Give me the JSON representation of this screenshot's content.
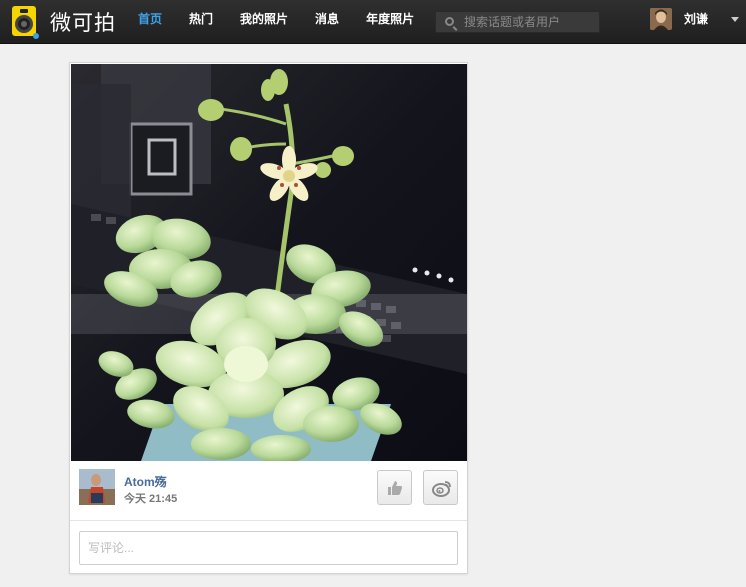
{
  "app": {
    "name": "微可拍",
    "logo_icon": "camera-app-icon"
  },
  "nav": {
    "items": [
      {
        "label": "首页",
        "active": true
      },
      {
        "label": "热门",
        "active": false
      },
      {
        "label": "我的照片",
        "active": false
      },
      {
        "label": "消息",
        "active": false
      },
      {
        "label": "年度照片",
        "active": false
      }
    ],
    "accent_color": "#3ea3e8"
  },
  "search": {
    "placeholder": "搜索话题或者用户",
    "value": "",
    "icon": "search-icon"
  },
  "user": {
    "name": "刘谦",
    "menu_icon": "caret-down-icon"
  },
  "post": {
    "photo": "succulent-flower-photo",
    "author": "Atom殇",
    "time": "今天 21:45",
    "like_icon": "thumbs-up-icon",
    "share_icon": "weibo-icon",
    "comment_placeholder": "写评论..."
  }
}
